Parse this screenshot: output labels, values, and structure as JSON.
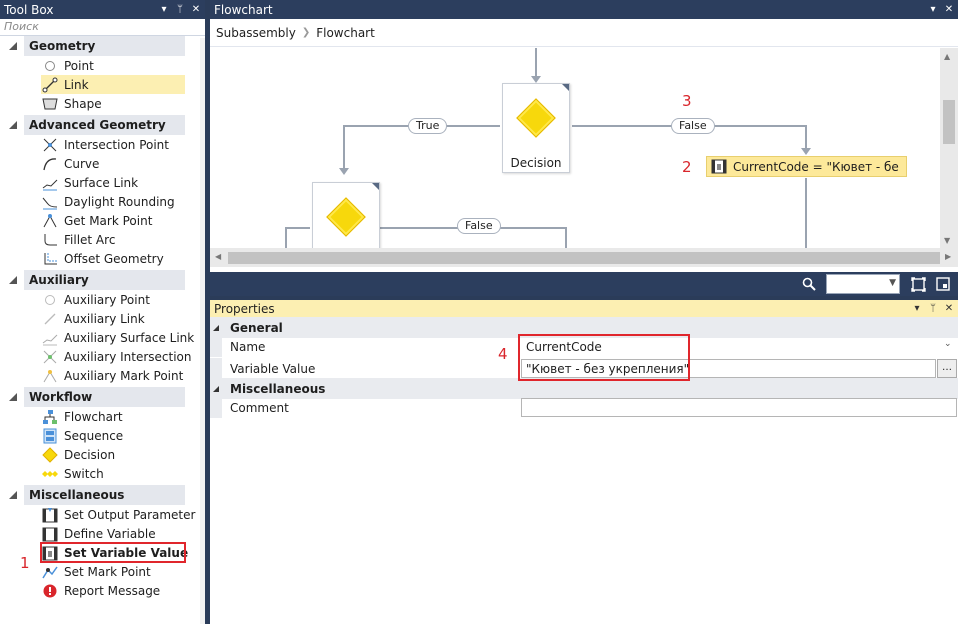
{
  "toolbox": {
    "title": "Tool Box",
    "search_placeholder": "Поиск",
    "categories": [
      {
        "label": "Geometry",
        "items": [
          {
            "label": "Point",
            "icon": "point-icon"
          },
          {
            "label": "Link",
            "icon": "link-icon",
            "selected": true
          },
          {
            "label": "Shape",
            "icon": "shape-icon"
          }
        ]
      },
      {
        "label": "Advanced Geometry",
        "items": [
          {
            "label": "Intersection Point",
            "icon": "intersection-point-icon"
          },
          {
            "label": "Curve",
            "icon": "curve-icon"
          },
          {
            "label": "Surface Link",
            "icon": "surface-link-icon"
          },
          {
            "label": "Daylight Rounding",
            "icon": "daylight-rounding-icon"
          },
          {
            "label": "Get Mark Point",
            "icon": "get-mark-point-icon"
          },
          {
            "label": "Fillet Arc",
            "icon": "fillet-arc-icon"
          },
          {
            "label": "Offset Geometry",
            "icon": "offset-geometry-icon"
          }
        ]
      },
      {
        "label": "Auxiliary",
        "items": [
          {
            "label": "Auxiliary Point",
            "icon": "auxiliary-point-icon"
          },
          {
            "label": "Auxiliary Link",
            "icon": "auxiliary-link-icon"
          },
          {
            "label": "Auxiliary Surface Link",
            "icon": "auxiliary-surface-link-icon"
          },
          {
            "label": "Auxiliary Intersection",
            "icon": "auxiliary-intersection-icon"
          },
          {
            "label": "Auxiliary Mark Point",
            "icon": "auxiliary-mark-point-icon"
          }
        ]
      },
      {
        "label": "Workflow",
        "items": [
          {
            "label": "Flowchart",
            "icon": "flowchart-icon"
          },
          {
            "label": "Sequence",
            "icon": "sequence-icon"
          },
          {
            "label": "Decision",
            "icon": "decision-icon"
          },
          {
            "label": "Switch",
            "icon": "switch-icon"
          }
        ]
      },
      {
        "label": "Miscellaneous",
        "items": [
          {
            "label": "Set Output Parameter",
            "icon": "set-output-parameter-icon"
          },
          {
            "label": "Define Variable",
            "icon": "define-variable-icon"
          },
          {
            "label": "Set Variable Value",
            "icon": "set-variable-value-icon",
            "highlighted": true
          },
          {
            "label": "Set Mark Point",
            "icon": "set-mark-point-icon"
          },
          {
            "label": "Report Message",
            "icon": "report-message-icon"
          }
        ]
      }
    ]
  },
  "flowchart": {
    "title": "Flowchart",
    "breadcrumb": [
      "Subassembly",
      "Flowchart"
    ],
    "nodes": {
      "decision_top_label": "Decision",
      "true_label": "True",
      "false_label_top": "False",
      "false_label_bottom": "False",
      "assign_label": "CurrentCode = \"Кювет - бе"
    }
  },
  "properties": {
    "title": "Properties",
    "sections": {
      "general": "General",
      "misc": "Miscellaneous"
    },
    "rows": {
      "name_key": "Name",
      "name_value": "CurrentCode",
      "varval_key": "Variable Value",
      "varval_value": "\"Кювет - без укрепления\"",
      "comment_key": "Comment",
      "comment_value": ""
    }
  },
  "annotations": {
    "n1": "1",
    "n2": "2",
    "n3": "3",
    "n4": "4"
  },
  "colors": {
    "header_bg": "#2c3e5e",
    "selection": "#fcefb2",
    "highlight_red": "#e0262c",
    "decision_yellow": "#f7d80c"
  }
}
